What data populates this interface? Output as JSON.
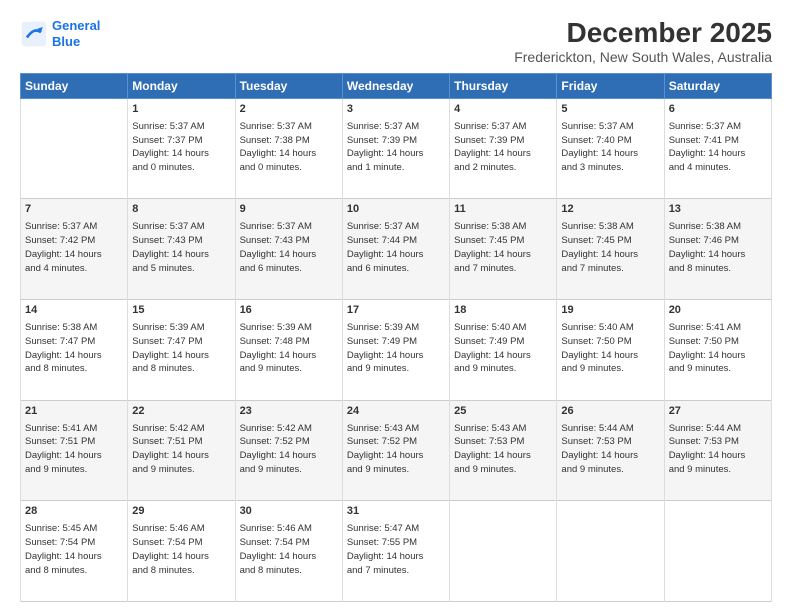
{
  "logo": {
    "line1": "General",
    "line2": "Blue"
  },
  "title": "December 2025",
  "subtitle": "Frederickton, New South Wales, Australia",
  "days_header": [
    "Sunday",
    "Monday",
    "Tuesday",
    "Wednesday",
    "Thursday",
    "Friday",
    "Saturday"
  ],
  "weeks": [
    [
      {
        "day": "",
        "content": ""
      },
      {
        "day": "1",
        "content": "Sunrise: 5:37 AM\nSunset: 7:37 PM\nDaylight: 14 hours\nand 0 minutes."
      },
      {
        "day": "2",
        "content": "Sunrise: 5:37 AM\nSunset: 7:38 PM\nDaylight: 14 hours\nand 0 minutes."
      },
      {
        "day": "3",
        "content": "Sunrise: 5:37 AM\nSunset: 7:39 PM\nDaylight: 14 hours\nand 1 minute."
      },
      {
        "day": "4",
        "content": "Sunrise: 5:37 AM\nSunset: 7:39 PM\nDaylight: 14 hours\nand 2 minutes."
      },
      {
        "day": "5",
        "content": "Sunrise: 5:37 AM\nSunset: 7:40 PM\nDaylight: 14 hours\nand 3 minutes."
      },
      {
        "day": "6",
        "content": "Sunrise: 5:37 AM\nSunset: 7:41 PM\nDaylight: 14 hours\nand 4 minutes."
      }
    ],
    [
      {
        "day": "7",
        "content": "Sunrise: 5:37 AM\nSunset: 7:42 PM\nDaylight: 14 hours\nand 4 minutes."
      },
      {
        "day": "8",
        "content": "Sunrise: 5:37 AM\nSunset: 7:43 PM\nDaylight: 14 hours\nand 5 minutes."
      },
      {
        "day": "9",
        "content": "Sunrise: 5:37 AM\nSunset: 7:43 PM\nDaylight: 14 hours\nand 6 minutes."
      },
      {
        "day": "10",
        "content": "Sunrise: 5:37 AM\nSunset: 7:44 PM\nDaylight: 14 hours\nand 6 minutes."
      },
      {
        "day": "11",
        "content": "Sunrise: 5:38 AM\nSunset: 7:45 PM\nDaylight: 14 hours\nand 7 minutes."
      },
      {
        "day": "12",
        "content": "Sunrise: 5:38 AM\nSunset: 7:45 PM\nDaylight: 14 hours\nand 7 minutes."
      },
      {
        "day": "13",
        "content": "Sunrise: 5:38 AM\nSunset: 7:46 PM\nDaylight: 14 hours\nand 8 minutes."
      }
    ],
    [
      {
        "day": "14",
        "content": "Sunrise: 5:38 AM\nSunset: 7:47 PM\nDaylight: 14 hours\nand 8 minutes."
      },
      {
        "day": "15",
        "content": "Sunrise: 5:39 AM\nSunset: 7:47 PM\nDaylight: 14 hours\nand 8 minutes."
      },
      {
        "day": "16",
        "content": "Sunrise: 5:39 AM\nSunset: 7:48 PM\nDaylight: 14 hours\nand 9 minutes."
      },
      {
        "day": "17",
        "content": "Sunrise: 5:39 AM\nSunset: 7:49 PM\nDaylight: 14 hours\nand 9 minutes."
      },
      {
        "day": "18",
        "content": "Sunrise: 5:40 AM\nSunset: 7:49 PM\nDaylight: 14 hours\nand 9 minutes."
      },
      {
        "day": "19",
        "content": "Sunrise: 5:40 AM\nSunset: 7:50 PM\nDaylight: 14 hours\nand 9 minutes."
      },
      {
        "day": "20",
        "content": "Sunrise: 5:41 AM\nSunset: 7:50 PM\nDaylight: 14 hours\nand 9 minutes."
      }
    ],
    [
      {
        "day": "21",
        "content": "Sunrise: 5:41 AM\nSunset: 7:51 PM\nDaylight: 14 hours\nand 9 minutes."
      },
      {
        "day": "22",
        "content": "Sunrise: 5:42 AM\nSunset: 7:51 PM\nDaylight: 14 hours\nand 9 minutes."
      },
      {
        "day": "23",
        "content": "Sunrise: 5:42 AM\nSunset: 7:52 PM\nDaylight: 14 hours\nand 9 minutes."
      },
      {
        "day": "24",
        "content": "Sunrise: 5:43 AM\nSunset: 7:52 PM\nDaylight: 14 hours\nand 9 minutes."
      },
      {
        "day": "25",
        "content": "Sunrise: 5:43 AM\nSunset: 7:53 PM\nDaylight: 14 hours\nand 9 minutes."
      },
      {
        "day": "26",
        "content": "Sunrise: 5:44 AM\nSunset: 7:53 PM\nDaylight: 14 hours\nand 9 minutes."
      },
      {
        "day": "27",
        "content": "Sunrise: 5:44 AM\nSunset: 7:53 PM\nDaylight: 14 hours\nand 9 minutes."
      }
    ],
    [
      {
        "day": "28",
        "content": "Sunrise: 5:45 AM\nSunset: 7:54 PM\nDaylight: 14 hours\nand 8 minutes."
      },
      {
        "day": "29",
        "content": "Sunrise: 5:46 AM\nSunset: 7:54 PM\nDaylight: 14 hours\nand 8 minutes."
      },
      {
        "day": "30",
        "content": "Sunrise: 5:46 AM\nSunset: 7:54 PM\nDaylight: 14 hours\nand 8 minutes."
      },
      {
        "day": "31",
        "content": "Sunrise: 5:47 AM\nSunset: 7:55 PM\nDaylight: 14 hours\nand 7 minutes."
      },
      {
        "day": "",
        "content": ""
      },
      {
        "day": "",
        "content": ""
      },
      {
        "day": "",
        "content": ""
      }
    ]
  ]
}
